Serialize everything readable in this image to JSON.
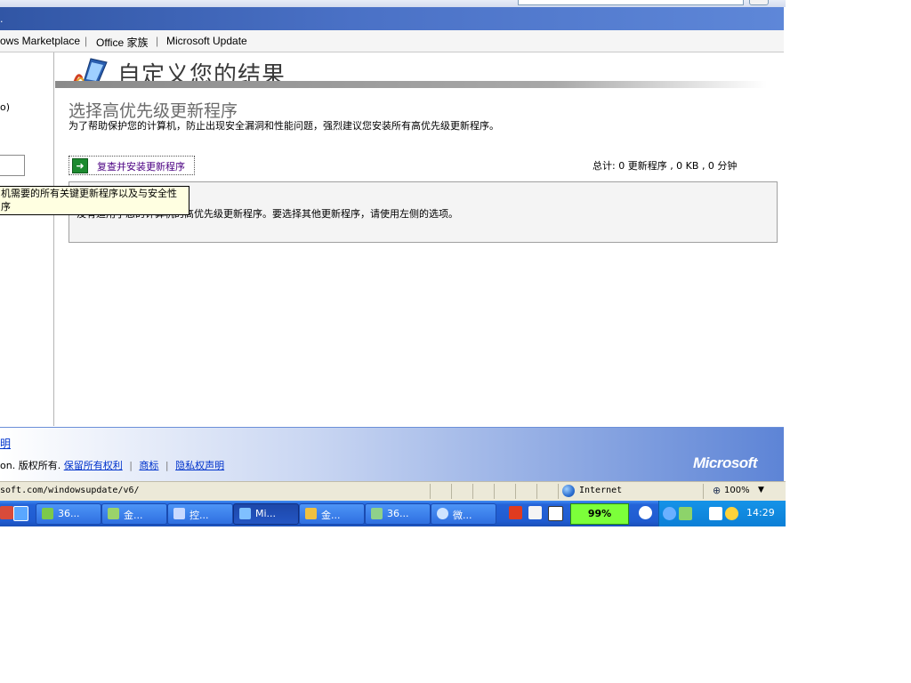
{
  "nav": {
    "items": [
      "ows Marketplace",
      "Office 家族",
      "Microsoft Update"
    ],
    "separator": "|"
  },
  "header": {
    "mark": "."
  },
  "left": {
    "fragment": "o)"
  },
  "main": {
    "page_title": "自定义您的结果",
    "section_title": "选择高优先级更新程序",
    "section_desc": "为了帮助保护您的计算机，防止出现安全漏洞和性能问题，强烈建议您安装所有高优先级更新程序。",
    "review_link": "复查并安装更新程序",
    "total": "总计:  0 更新程序 , 0 KB , 0 分钟",
    "info_text": "没有适用于您的计算机的高优先级更新程序。要选择其他更新程序，请使用左侧的选项。"
  },
  "tooltip": {
    "line1": "机需要的所有关键更新程序以及与安全性",
    "line2": "序"
  },
  "footer": {
    "link1": "明",
    "copyright": "on. 版权所有.",
    "links": [
      "保留所有权利",
      "商标",
      "隐私权声明"
    ],
    "logo": "Microsoft"
  },
  "status": {
    "url": "soft.com/windowsupdate/v6/",
    "zone": "Internet",
    "zoom": "100%",
    "zoom_icon": "⊕"
  },
  "taskbar": {
    "buttons": [
      {
        "label": "36...",
        "icon": "shield-icon",
        "color": "#7cc94a"
      },
      {
        "label": "金...",
        "icon": "app-icon",
        "color": "#9ad36a"
      },
      {
        "label": "控...",
        "icon": "control-panel-icon",
        "color": "#c9d9ff"
      },
      {
        "label": "Mi...",
        "icon": "ie-icon",
        "color": "#7fc0ff"
      },
      {
        "label": "金...",
        "icon": "app-icon",
        "color": "#f0c040"
      },
      {
        "label": "36...",
        "icon": "app-icon",
        "color": "#8fd18a"
      },
      {
        "label": "微...",
        "icon": "globe-icon",
        "color": "#cfe4ff"
      }
    ],
    "battery": "99%",
    "clock": "14:29"
  }
}
